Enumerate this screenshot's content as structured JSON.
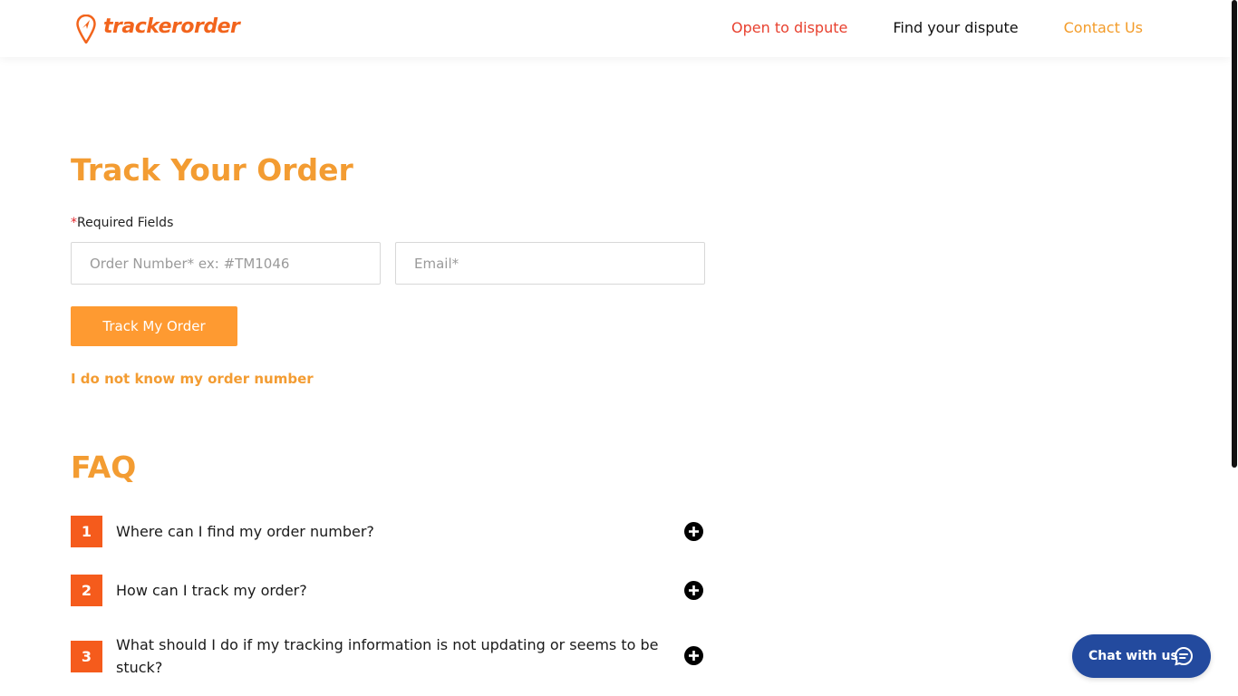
{
  "header": {
    "logo_text": "trackerorder",
    "nav": [
      {
        "label": "Open to dispute",
        "color": "#e8412f"
      },
      {
        "label": "Find your dispute",
        "color": "#111111"
      },
      {
        "label": "Contact Us",
        "color": "#f39c2a"
      }
    ]
  },
  "main": {
    "title": "Track Your Order",
    "required_star": "*",
    "required_label": "Required Fields",
    "order_placeholder": "Order Number* ex: #TM1046",
    "email_placeholder": "Email*",
    "track_button": "Track My Order",
    "no_order_link": "I do not know my order number"
  },
  "faq": {
    "title": "FAQ",
    "items": [
      {
        "num": "1",
        "question": "Where can I find my order number?"
      },
      {
        "num": "2",
        "question": "How can I track my order?"
      },
      {
        "num": "3",
        "question": "What should I do if my tracking information is not updating or seems to be stuck?"
      }
    ]
  },
  "chat": {
    "label": "Chat with us"
  },
  "colors": {
    "accent_orange": "#f39c32",
    "button_orange": "#fe9a31",
    "faq_number": "#f55b1c",
    "chat_blue": "#234a9e"
  },
  "icons": {
    "logo": "location-pin-icon",
    "faq_expand": "plus-circle-icon",
    "chat": "chat-bubble-icon"
  }
}
